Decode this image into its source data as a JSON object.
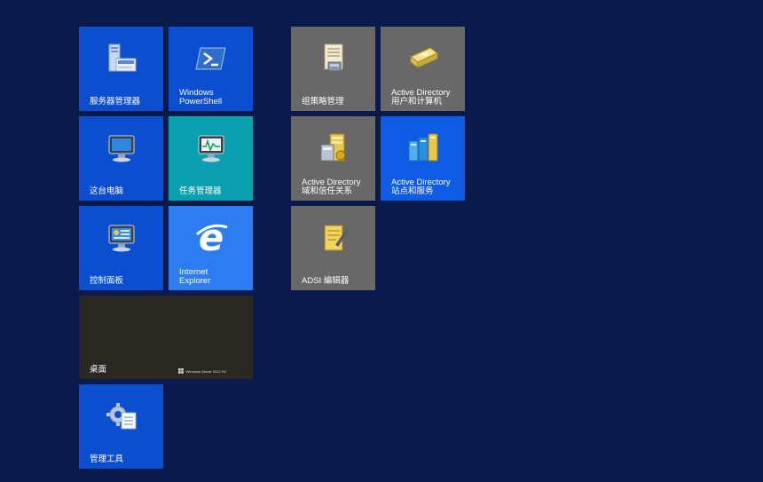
{
  "tiles": [
    {
      "id": "server-manager",
      "label": "服务器管理器",
      "icon": "server-manager-icon"
    },
    {
      "id": "powershell",
      "label": "Windows\nPowerShell",
      "icon": "powershell-icon"
    },
    {
      "id": "this-pc",
      "label": "这台电脑",
      "icon": "computer-icon"
    },
    {
      "id": "task-manager",
      "label": "任务管理器",
      "icon": "task-manager-icon"
    },
    {
      "id": "control-panel",
      "label": "控制面板",
      "icon": "control-panel-icon"
    },
    {
      "id": "internet-explorer",
      "label": "Internet\nExplorer",
      "icon": "internet-explorer-icon"
    },
    {
      "id": "desktop",
      "label": "桌面",
      "watermark": "Windows Server 2012 R2"
    },
    {
      "id": "admin-tools",
      "label": "管理工具",
      "icon": "admin-tools-icon"
    },
    {
      "id": "group-policy",
      "label": "组策略管理",
      "icon": "group-policy-icon"
    },
    {
      "id": "ad-users",
      "label": "Active Directory\n用户和计算机",
      "icon": "ad-users-icon"
    },
    {
      "id": "ad-domains",
      "label": "Active Directory\n域和信任关系",
      "icon": "ad-domains-icon"
    },
    {
      "id": "ad-sites",
      "label": "Active Directory\n站点和服务",
      "icon": "ad-sites-icon"
    },
    {
      "id": "adsi-edit",
      "label": "ADSI 编辑器",
      "icon": "adsi-edit-icon"
    }
  ],
  "colors": {
    "background": "#0a1a4a",
    "tile_blue": "#0b4fd0",
    "tile_teal": "#0aa0b0",
    "tile_gray": "#686868",
    "tile_desktop": "#2b2824"
  }
}
